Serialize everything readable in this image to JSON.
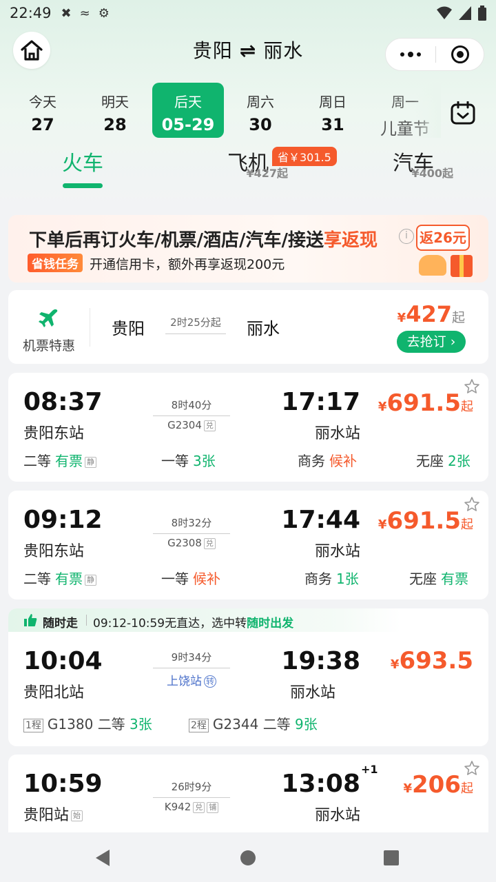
{
  "status_bar": {
    "time": "22:49"
  },
  "header": {
    "origin": "贵阳",
    "swap_symbol": "⇌",
    "destination": "丽水"
  },
  "dates": [
    {
      "weekday": "今天",
      "date": "27"
    },
    {
      "weekday": "明天",
      "date": "28"
    },
    {
      "weekday": "后天",
      "date": "05-29",
      "selected": true
    },
    {
      "weekday": "周六",
      "date": "30"
    },
    {
      "weekday": "周日",
      "date": "31"
    },
    {
      "weekday": "周一",
      "date": "儿童节"
    }
  ],
  "modes": [
    {
      "label": "火车",
      "price": "",
      "active": true
    },
    {
      "label": "飞机",
      "price": "¥427起",
      "badge": "省￥301.5"
    },
    {
      "label": "汽车",
      "price": "¥400起"
    }
  ],
  "promo": {
    "headline_main": "下单后再订火车/机票/酒店/汽车/接送",
    "headline_highlight": "享返现",
    "info": "i",
    "task_badge": "省钱任务",
    "sub": "开通信用卡，额外再享返现200元",
    "gift_text": "返26元"
  },
  "flight_card": {
    "label": "机票特惠",
    "from": "贵阳",
    "duration": "2时25分起",
    "to": "丽水",
    "currency": "¥",
    "price": "427",
    "suffix": "起",
    "button": "去抢订 ›"
  },
  "trains": [
    {
      "dep_time": "08:37",
      "dep_station": "贵阳东站",
      "duration": "8时40分",
      "train_no": "G2304",
      "tags": [
        "兑"
      ],
      "arr_time": "17:17",
      "arr_station": "丽水站",
      "currency": "¥",
      "price": "691.5",
      "suffix": "起",
      "seats": [
        {
          "class": "二等",
          "status": "有票",
          "type": "av",
          "tag": "静"
        },
        {
          "class": "一等",
          "status": "3张",
          "type": "av"
        },
        {
          "class": "商务",
          "status": "候补",
          "type": "wl"
        },
        {
          "class": "无座",
          "status": "2张",
          "type": "av"
        }
      ]
    },
    {
      "dep_time": "09:12",
      "dep_station": "贵阳东站",
      "duration": "8时32分",
      "train_no": "G2308",
      "tags": [
        "兑"
      ],
      "arr_time": "17:44",
      "arr_station": "丽水站",
      "currency": "¥",
      "price": "691.5",
      "suffix": "起",
      "seats": [
        {
          "class": "二等",
          "status": "有票",
          "type": "av",
          "tag": "静"
        },
        {
          "class": "一等",
          "status": "候补",
          "type": "wl"
        },
        {
          "class": "商务",
          "status": "1张",
          "type": "av"
        },
        {
          "class": "无座",
          "status": "有票",
          "type": "av"
        }
      ]
    }
  ],
  "transfer": {
    "banner_title": "随时走",
    "banner_text": "09:12-10:59无直达，选中转",
    "banner_highlight": "随时出发",
    "dep_time": "10:04",
    "dep_station": "贵阳北站",
    "duration": "9时34分",
    "via": "上饶站",
    "via_tag": "转",
    "arr_time": "19:38",
    "arr_station": "丽水站",
    "currency": "¥",
    "price": "693.5",
    "legs": [
      {
        "leg": "1程",
        "train": "G1380",
        "class": "二等",
        "count": "3张"
      },
      {
        "leg": "2程",
        "train": "G2344",
        "class": "二等",
        "count": "9张"
      }
    ]
  },
  "last_train": {
    "dep_time": "10:59",
    "dep_station": "贵阳站",
    "dep_tag": "始",
    "duration": "26时9分",
    "train_no": "K942",
    "tags": [
      "兑",
      "铺"
    ],
    "arr_time": "13:08",
    "day_offset": "+1",
    "arr_station": "丽水站",
    "currency": "¥",
    "price": "206",
    "suffix": "起"
  },
  "colors": {
    "accent": "#10b46e",
    "price": "#f55a2c",
    "via": "#4a6fc9"
  }
}
